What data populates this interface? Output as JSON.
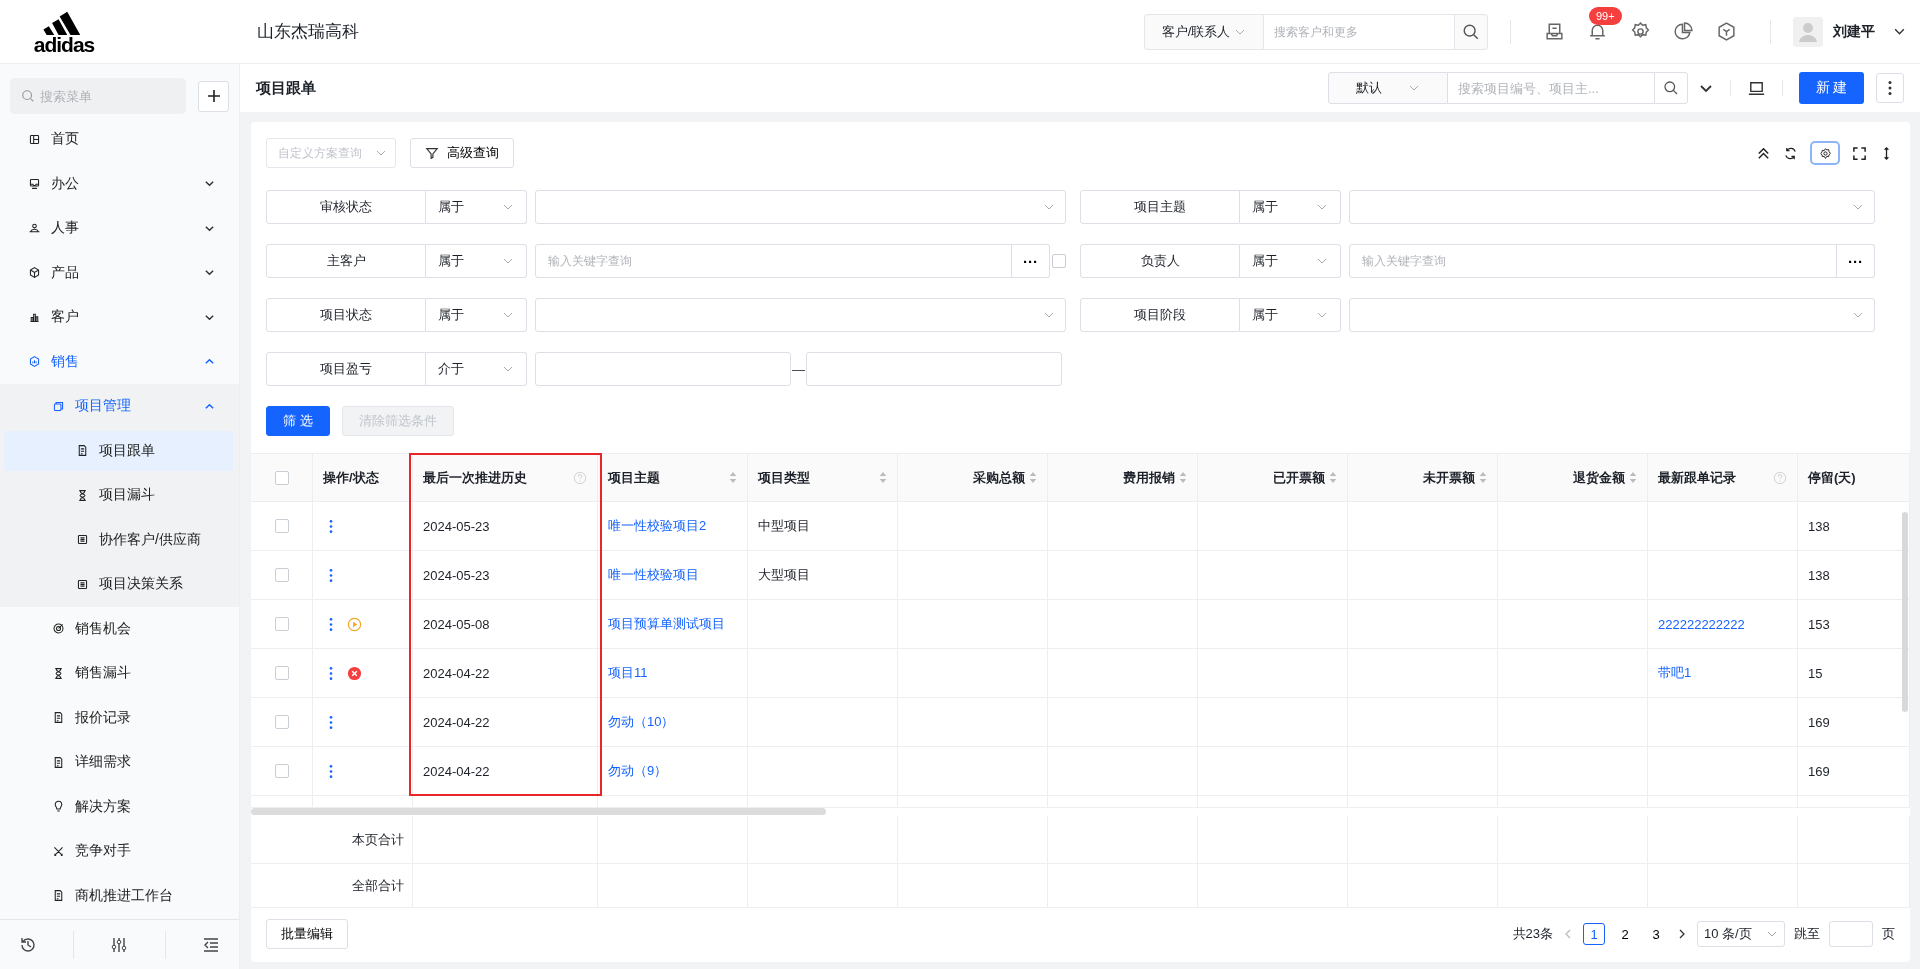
{
  "logo": {
    "text": "adidas"
  },
  "company": "山东杰瑞高科",
  "global_search": {
    "scope": "客户/联系人",
    "placeholder": "搜索客户和更多"
  },
  "notifications": {
    "badge": "99+"
  },
  "user": {
    "name": "刘建平"
  },
  "sidebar": {
    "search_placeholder": "搜索菜单",
    "items": [
      {
        "kind": "link",
        "label": "首页",
        "selected": false
      },
      {
        "kind": "group",
        "label": "办公",
        "expanded": false
      },
      {
        "kind": "group",
        "label": "人事",
        "expanded": false
      },
      {
        "kind": "group",
        "label": "产品",
        "expanded": false
      },
      {
        "kind": "group",
        "label": "客户",
        "expanded": false
      },
      {
        "kind": "group",
        "label": "销售",
        "expanded": true,
        "children": [
          {
            "kind": "group",
            "label": "项目管理",
            "expanded": true,
            "children": [
              {
                "kind": "link",
                "label": "项目跟单",
                "selected": true
              },
              {
                "kind": "link",
                "label": "项目漏斗",
                "selected": false
              },
              {
                "kind": "link",
                "label": "协作客户/供应商",
                "selected": false
              },
              {
                "kind": "link",
                "label": "项目决策关系",
                "selected": false
              }
            ]
          },
          {
            "kind": "link",
            "label": "销售机会",
            "selected": false
          },
          {
            "kind": "link",
            "label": "销售漏斗",
            "selected": false
          },
          {
            "kind": "link",
            "label": "报价记录",
            "selected": false
          },
          {
            "kind": "link",
            "label": "详细需求",
            "selected": false
          },
          {
            "kind": "link",
            "label": "解决方案",
            "selected": false
          },
          {
            "kind": "link",
            "label": "竞争对手",
            "selected": false
          },
          {
            "kind": "link",
            "label": "商机推进工作台",
            "selected": false
          }
        ]
      }
    ]
  },
  "page": {
    "title": "项目跟单",
    "view": "默认",
    "search_placeholder": "搜索项目编号、项目主...",
    "new_button": "新 建"
  },
  "filter_toolbar": {
    "scheme_placeholder": "自定义方案查询",
    "advanced": "高级查询"
  },
  "filters": [
    {
      "kind": "select",
      "label": "审核状态",
      "operator": "属于"
    },
    {
      "kind": "select",
      "label": "项目主题",
      "operator": "属于"
    },
    {
      "kind": "lookup",
      "label": "主客户",
      "operator": "属于",
      "placeholder": "输入关键字查询",
      "lookup_button": "···",
      "checkbox": {
        "checked": false
      }
    },
    {
      "kind": "lookup",
      "label": "负责人",
      "operator": "属于",
      "placeholder": "输入关键字查询",
      "lookup_button": "···"
    },
    {
      "kind": "select",
      "label": "项目状态",
      "operator": "属于"
    },
    {
      "kind": "select",
      "label": "项目阶段",
      "operator": "属于"
    },
    {
      "kind": "range",
      "label": "项目盈亏",
      "operator": "介于",
      "separator": "—"
    }
  ],
  "filter_actions": [
    {
      "label": "筛 选",
      "primary": true,
      "disabled": false
    },
    {
      "label": "清除筛选条件",
      "primary": false,
      "disabled": true
    }
  ],
  "table": {
    "select_all": {
      "checked": false
    },
    "columns": [
      {
        "title": "操作/状态",
        "kind": "text",
        "sortable": false,
        "help": false,
        "highlighted": false
      },
      {
        "title": "最后一次推进历史",
        "kind": "text",
        "sortable": false,
        "help": true,
        "highlighted": true
      },
      {
        "title": "项目主题",
        "kind": "text",
        "sortable": true,
        "help": false,
        "highlighted": false
      },
      {
        "title": "项目类型",
        "kind": "text",
        "sortable": true,
        "help": false,
        "highlighted": false
      },
      {
        "title": "采购总额",
        "kind": "amount",
        "sortable": true,
        "help": false,
        "highlighted": false
      },
      {
        "title": "费用报销",
        "kind": "amount",
        "sortable": true,
        "help": false,
        "highlighted": false
      },
      {
        "title": "已开票额",
        "kind": "amount",
        "sortable": true,
        "help": false,
        "highlighted": false
      },
      {
        "title": "未开票额",
        "kind": "amount",
        "sortable": true,
        "help": false,
        "highlighted": false
      },
      {
        "title": "退货金额",
        "kind": "amount",
        "sortable": true,
        "help": false,
        "highlighted": false
      },
      {
        "title": "最新跟单记录",
        "kind": "text",
        "sortable": false,
        "help": true,
        "highlighted": false
      },
      {
        "title": "停留(天)",
        "kind": "text",
        "sortable": false,
        "help": false,
        "highlighted": false
      }
    ],
    "rows": [
      {
        "checked": false,
        "running": false,
        "failed": false,
        "last_push": "2024-05-23",
        "theme": "唯一性校验项目2",
        "type": "中型项目",
        "latest_record": "",
        "stay": "138"
      },
      {
        "checked": false,
        "running": false,
        "failed": false,
        "last_push": "2024-05-23",
        "theme": "唯一性校验项目",
        "type": "大型项目",
        "latest_record": "",
        "stay": "138"
      },
      {
        "checked": false,
        "running": true,
        "failed": false,
        "last_push": "2024-05-08",
        "theme": "项目预算单测试项目",
        "type": "",
        "latest_record": "222222222222",
        "stay": "153"
      },
      {
        "checked": false,
        "running": false,
        "failed": true,
        "last_push": "2024-04-22",
        "theme": "项目11",
        "type": "",
        "latest_record": "带吧1",
        "stay": "15"
      },
      {
        "checked": false,
        "running": false,
        "failed": false,
        "last_push": "2024-04-22",
        "theme": "勿动（10）",
        "type": "",
        "latest_record": "",
        "stay": "169"
      },
      {
        "checked": false,
        "running": false,
        "failed": false,
        "last_push": "2024-04-22",
        "theme": "勿动（9）",
        "type": "",
        "latest_record": "",
        "stay": "169"
      }
    ],
    "summary_rows": [
      "本页合计",
      "全部合计"
    ]
  },
  "footer": {
    "batch_edit": "批量编辑",
    "total": "共23条",
    "pages": [
      {
        "label": "1",
        "selected": true
      },
      {
        "label": "2",
        "selected": false
      },
      {
        "label": "3",
        "selected": false
      }
    ],
    "page_size": "10 条/页",
    "jump_label": "跳至",
    "page_unit": "页"
  }
}
